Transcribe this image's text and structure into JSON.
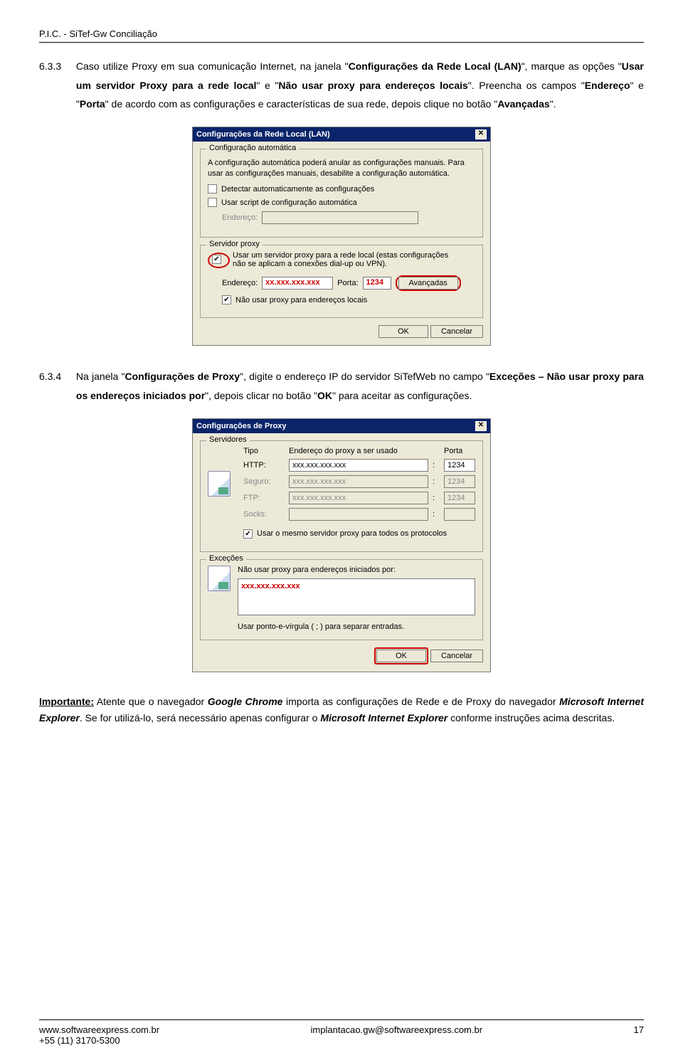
{
  "header": {
    "title": "P.I.C. - SiTef-Gw Conciliação"
  },
  "p1": {
    "num": "6.3.3",
    "t1": "Caso utilize Proxy em sua comunicação Internet, na janela \"",
    "b1": "Configurações da Rede Local (LAN)",
    "t2": "\", marque as opções \"",
    "b2": "Usar um servidor Proxy para a rede local",
    "t3": "\" e \"",
    "b3": "Não usar proxy para endereços locais",
    "t4": "\". Preencha os campos \"",
    "b4": "Endereço",
    "t5": "\" e \"",
    "b5": "Porta",
    "t6": "\" de acordo com as configurações e características de sua rede, depois clique no botão \"",
    "b6": "Avançadas",
    "t7": "\"."
  },
  "dlg1": {
    "title": "Configurações da Rede Local (LAN)",
    "fs1": {
      "legend": "Configuração automática",
      "txt": "A configuração automática poderá anular as configurações manuais. Para usar as configurações manuais, desabilite a configuração automática.",
      "chk1": "Detectar automaticamente as configurações",
      "chk2": "Usar script de configuração automática",
      "lblEndereco": "Endereço:"
    },
    "fs2": {
      "legend": "Servidor proxy",
      "chk1a": "Usar um servidor proxy para a rede local (estas configurações",
      "chk1b": "não se aplicam a conexões dial-up ou VPN).",
      "lblEndereco": "Endereço:",
      "valEndereco": "xx.xxx.xxx.xxx",
      "lblPorta": "Porta:",
      "valPorta": "1234",
      "btnAvanc": "Avançadas",
      "chk2": "Não usar proxy para endereços locais"
    },
    "btnOk": "OK",
    "btnCancel": "Cancelar"
  },
  "p2": {
    "num": "6.3.4",
    "t1": "Na janela \"",
    "b1": "Configurações de Proxy",
    "t2": "\", digite o endereço IP do servidor SiTefWeb no campo \"",
    "b2": "Exceções – Não usar proxy para os endereços iniciados por",
    "t3": "\", depois clicar no botão \"",
    "b3": "OK",
    "t4": "\" para aceitar as configurações."
  },
  "dlg2": {
    "title": "Configurações de Proxy",
    "fs1": {
      "legend": "Servidores",
      "colTipo": "Tipo",
      "colEnd": "Endereço do proxy a ser usado",
      "colPorta": "Porta",
      "rHttp": "HTTP:",
      "rSeguro": "Seguro:",
      "rFtp": "FTP:",
      "rSocks": "Socks:",
      "valAddr": "xxx.xxx.xxx.xxx",
      "valPort": "1234",
      "chk": "Usar o mesmo servidor proxy para todos os protocolos"
    },
    "fs2": {
      "legend": "Exceções",
      "lbl": "Não usar proxy para endereços iniciados por:",
      "val": "xxx.xxx.xxx.xxx",
      "hint": "Usar ponto-e-vírgula ( ; ) para separar entradas."
    },
    "btnOk": "OK",
    "btnCancel": "Cancelar"
  },
  "note": {
    "b1": "Importante:",
    "t1": " Atente que o navegador ",
    "i1": "Google Chrome",
    "t2": " importa as configurações de Rede e de Proxy do navegador ",
    "i2": "Microsoft Internet Explorer",
    "t3": ". Se for utilizá-lo, será necessário apenas configurar o ",
    "i3": "Microsoft Internet Explorer",
    "t4": " conforme instruções acima descritas."
  },
  "footer": {
    "left1": "www.softwareexpress.com.br",
    "left2": "+55 (11) 3170-5300",
    "center": "implantacao.gw@softwareexpress.com.br",
    "right": "17"
  }
}
